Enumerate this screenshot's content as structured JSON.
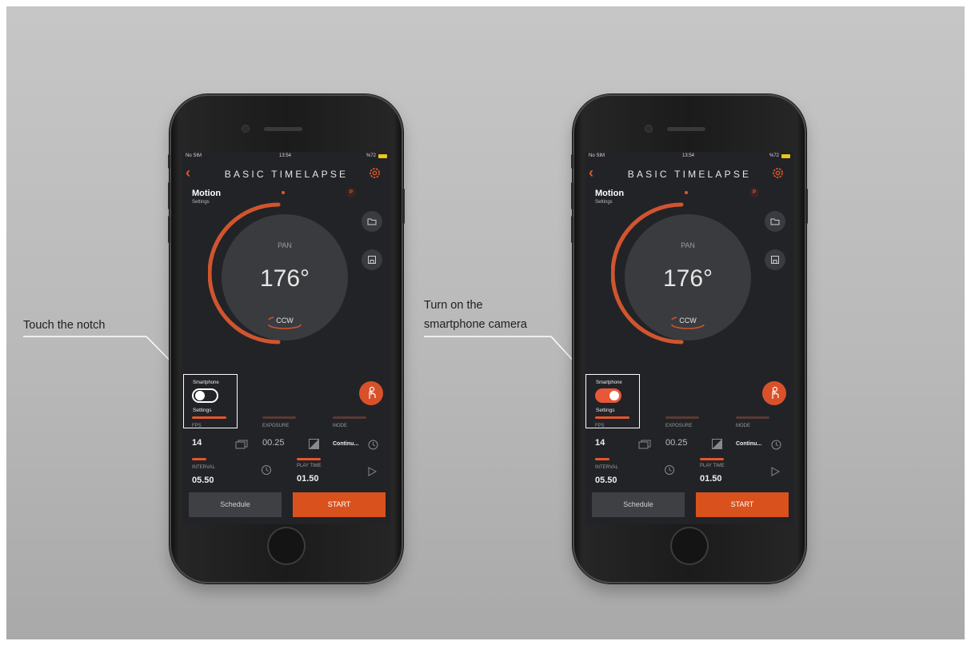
{
  "status_bar": {
    "carrier": "No SIM",
    "time": "13:54",
    "battery": "%72"
  },
  "screen": {
    "title": "BASIC TIMELAPSE",
    "motion_label": "Motion",
    "motion_sub": "Settings",
    "p_badge": "P",
    "dial": {
      "axis": "PAN",
      "angle": "176°",
      "direction": "CCW"
    },
    "smartphone": {
      "label": "Smartphone",
      "settings": "Settings"
    },
    "params": {
      "fps_label": "FPS",
      "fps_value": "14",
      "exposure_label": "EXPOSURE",
      "exposure_value": "00.25",
      "mode_label": "MODE",
      "mode_value": "Continu...",
      "interval_label": "INTERVAL",
      "interval_value": "05.50",
      "playtime_label": "PLAY TIME",
      "playtime_value": "01.50"
    },
    "schedule_button": "Schedule",
    "start_button": "START"
  },
  "left_phone": {
    "smartphone_toggle_on": false
  },
  "right_phone": {
    "smartphone_toggle_on": true
  },
  "callouts": {
    "left": "Touch the notch",
    "right_line1": "Turn on the",
    "right_line2": "smartphone camera"
  },
  "colors": {
    "accent": "#e2572c",
    "screen_bg": "#222327",
    "dial_bg": "#3a3b3f",
    "toggle_on": "#e8573a"
  }
}
